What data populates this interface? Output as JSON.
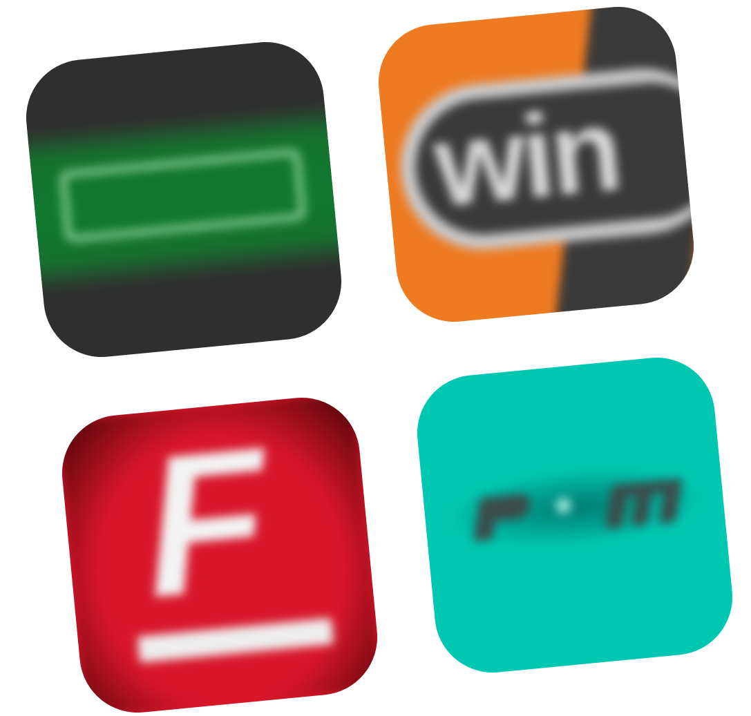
{
  "tiles": [
    {
      "name": "green-band-app-icon",
      "colors": {
        "background": "#2f2f2f",
        "band": "#0f7a2f",
        "frame": "#7fc891"
      },
      "text": ""
    },
    {
      "name": "win-app-icon",
      "colors": {
        "left": "#ee7a22",
        "right": "#3a3a3a",
        "pill": "#c8c8c8",
        "text": "#d7d7d7"
      },
      "text": "win"
    },
    {
      "name": "red-f-app-icon",
      "colors": {
        "background": "#d8162a",
        "letter": "#f3f3f3"
      },
      "text": "F"
    },
    {
      "name": "teal-app-icon",
      "colors": {
        "background": "#00c7b2",
        "wordmark": "#3a4d4a",
        "dot": "#9be9de"
      },
      "text": ""
    }
  ]
}
